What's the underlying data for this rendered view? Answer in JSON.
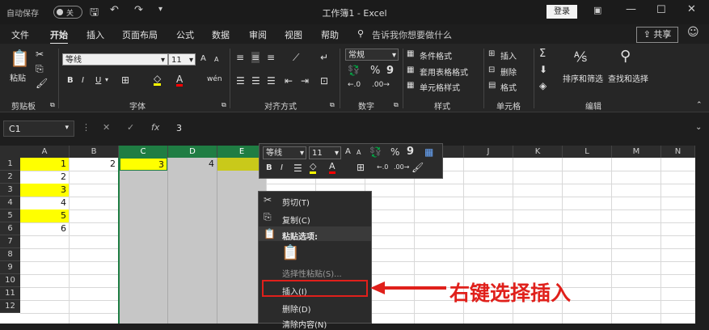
{
  "titlebar": {
    "autosave_label": "自动保存",
    "autosave_state": "关",
    "title": "工作簿1 - Excel",
    "login_label": "登录",
    "save_icon": "save-icon",
    "undo_icon": "undo-icon",
    "redo_icon": "redo-icon"
  },
  "menu": {
    "tabs": [
      "文件",
      "开始",
      "插入",
      "页面布局",
      "公式",
      "数据",
      "审阅",
      "视图",
      "帮助"
    ],
    "active_tab": "开始",
    "search_hint": "告诉我你想要做什么",
    "share_label": "共享"
  },
  "ribbon": {
    "clipboard": {
      "paste_label": "粘贴",
      "group_label": "剪贴板"
    },
    "font": {
      "font_name": "等线",
      "font_size": "11",
      "group_label": "字体",
      "bold": "B",
      "italic": "I",
      "underline": "U",
      "grow": "A",
      "shrink": "A",
      "font_color_letter": "A",
      "phonetic": "wén"
    },
    "alignment": {
      "group_label": "对齐方式"
    },
    "number": {
      "format": "常规",
      "percent": "%",
      "comma": "9",
      "group_label": "数字"
    },
    "styles": {
      "conditional": "条件格式",
      "table": "套用表格格式",
      "cell": "单元格样式",
      "group_label": "样式"
    },
    "cells": {
      "insert": "插入",
      "delete": "删除",
      "format": "格式",
      "group_label": "单元格"
    },
    "editing": {
      "sort": "排序和筛选",
      "find": "查找和选择",
      "group_label": "编辑"
    }
  },
  "formula_bar": {
    "name_box": "C1",
    "fx": "fx",
    "value": "3"
  },
  "sheet": {
    "columns": [
      "A",
      "B",
      "C",
      "D",
      "E",
      "F",
      "G",
      "H",
      "I",
      "J",
      "K",
      "L",
      "M",
      "N"
    ],
    "selected_columns": [
      "C",
      "D",
      "E"
    ],
    "rows": [
      "1",
      "2",
      "3",
      "4",
      "5",
      "6",
      "7",
      "8",
      "9",
      "10",
      "11",
      "12"
    ],
    "cells": {
      "A1": "1",
      "A2": "2",
      "A3": "3",
      "A4": "4",
      "A5": "5",
      "A6": "6",
      "B1": "2",
      "C1": "3",
      "D1": "4"
    },
    "highlight_color": "#ffff00"
  },
  "mini_toolbar": {
    "font_name": "等线",
    "font_size": "11",
    "percent": "%",
    "comma": "9",
    "bold": "B",
    "italic": "I",
    "font_color_letter": "A"
  },
  "context_menu": {
    "cut": "剪切(T)",
    "copy": "复制(C)",
    "paste_options": "粘贴选项:",
    "paste_special": "选择性粘贴(S)...",
    "insert": "插入(I)",
    "delete": "删除(D)",
    "clear": "清除内容(N)"
  },
  "annotation": {
    "text": "右键选择插入",
    "color": "#e0201b"
  }
}
